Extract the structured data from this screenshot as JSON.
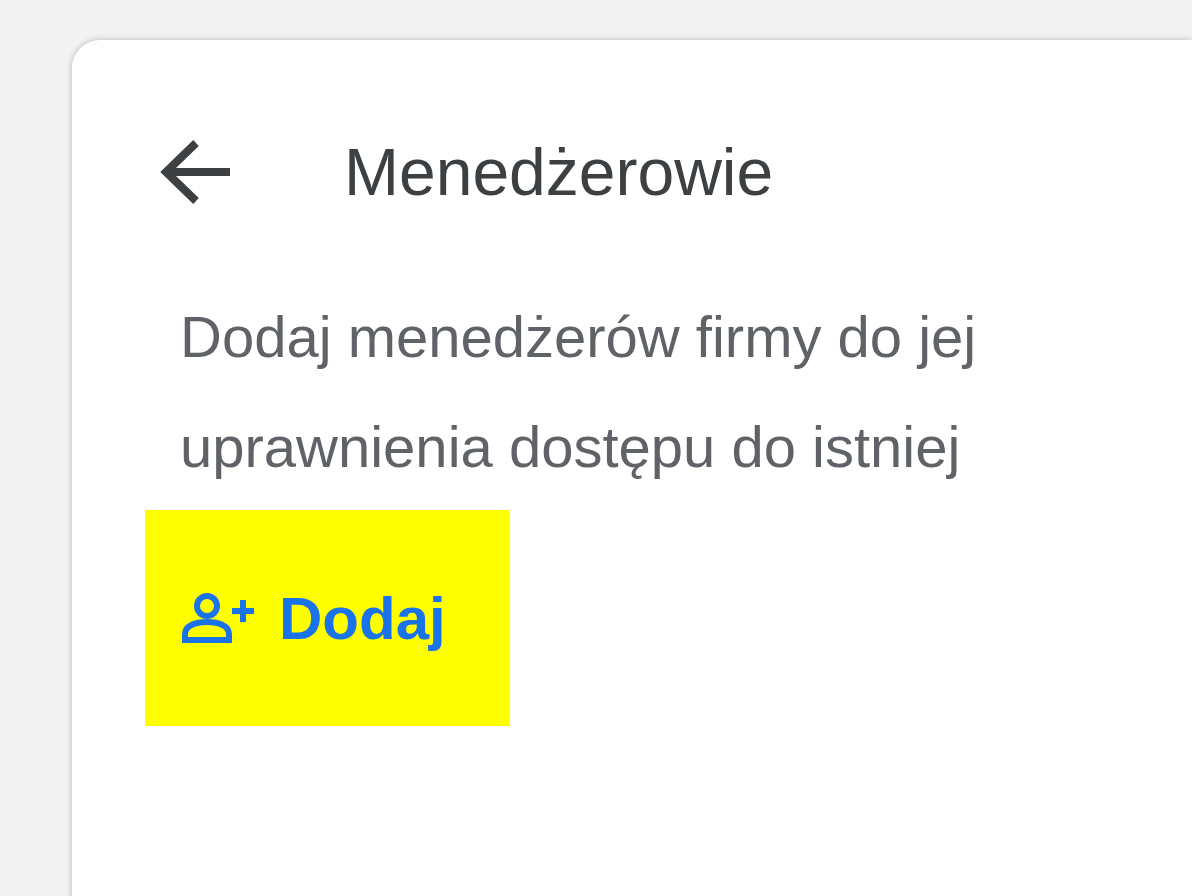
{
  "header": {
    "title": "Menedżerowie"
  },
  "description_lines": [
    "Dodaj menedżerów firmy do jej",
    "uprawnienia dostępu do istniej"
  ],
  "add_button": {
    "label": "Dodaj",
    "highlighted": true
  }
}
